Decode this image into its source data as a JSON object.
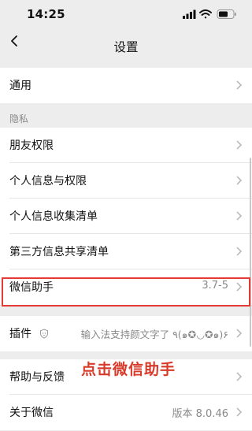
{
  "status_bar": {
    "time": "14:25"
  },
  "nav": {
    "title": "设置"
  },
  "groups": {
    "general": {
      "items": [
        {
          "label": "通用"
        }
      ]
    },
    "privacy_header": "隐私",
    "privacy": {
      "items": [
        {
          "label": "朋友权限"
        },
        {
          "label": "个人信息与权限"
        },
        {
          "label": "个人信息收集清单"
        },
        {
          "label": "第三方信息共享清单"
        },
        {
          "label": "微信助手",
          "value": "3.7-5"
        }
      ]
    },
    "plugins": {
      "label": "插件",
      "value": "输入法支持颜文字了 ٩(๑✪◡✪๑)۶"
    },
    "about": {
      "items": [
        {
          "label": "帮助与反馈"
        },
        {
          "label": "关于微信",
          "value": "版本 8.0.46"
        }
      ]
    }
  },
  "annotation": "点击微信助手",
  "colors": {
    "highlight": "#e53935",
    "annotation": "#d83a2a"
  }
}
